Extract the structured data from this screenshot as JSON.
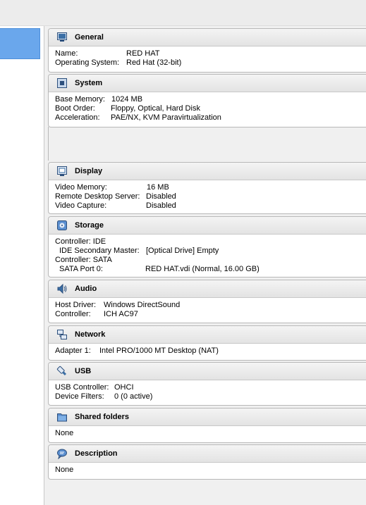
{
  "sections": {
    "general": {
      "title": "General",
      "icon": "monitor-icon",
      "rows": [
        {
          "k": "Name:",
          "v": "RED HAT"
        },
        {
          "k": "Operating System:",
          "v": "Red Hat (32-bit)"
        }
      ]
    },
    "system": {
      "title": "System",
      "icon": "chip-icon",
      "rows": [
        {
          "k": "Base Memory:",
          "v": "1024 MB"
        },
        {
          "k": "Boot Order:",
          "v": "Floppy, Optical, Hard Disk"
        },
        {
          "k": "Acceleration:",
          "v": "PAE/NX, KVM Paravirtualization"
        }
      ]
    },
    "display": {
      "title": "Display",
      "icon": "display-icon",
      "rows": [
        {
          "k": "Video Memory:",
          "v": "16 MB"
        },
        {
          "k": "Remote Desktop Server:",
          "v": "Disabled"
        },
        {
          "k": "Video Capture:",
          "v": "Disabled"
        }
      ]
    },
    "storage": {
      "title": "Storage",
      "icon": "storage-icon",
      "rows": [
        {
          "k": "Controller: IDE",
          "v": ""
        },
        {
          "k": "IDE Secondary Master:",
          "v": "[Optical Drive] Empty"
        },
        {
          "k": "Controller: SATA",
          "v": ""
        },
        {
          "k": "SATA Port 0:",
          "v": "RED HAT.vdi (Normal, 16.00 GB)"
        }
      ]
    },
    "audio": {
      "title": "Audio",
      "icon": "speaker-icon",
      "rows": [
        {
          "k": "Host Driver:",
          "v": "Windows DirectSound"
        },
        {
          "k": "Controller:",
          "v": "ICH AC97"
        }
      ]
    },
    "network": {
      "title": "Network",
      "icon": "network-icon",
      "rows": [
        {
          "k": "Adapter 1:",
          "v": "Intel PRO/1000 MT Desktop (NAT)"
        }
      ]
    },
    "usb": {
      "title": "USB",
      "icon": "usb-icon",
      "rows": [
        {
          "k": "USB Controller:",
          "v": "OHCI"
        },
        {
          "k": "Device Filters:",
          "v": "0 (0 active)"
        }
      ]
    },
    "shared_folders": {
      "title": "Shared folders",
      "icon": "folder-icon",
      "rows": [
        {
          "k": "None",
          "v": ""
        }
      ]
    },
    "description": {
      "title": "Description",
      "icon": "speech-bubble-icon",
      "rows": [
        {
          "k": "None",
          "v": ""
        }
      ]
    }
  }
}
